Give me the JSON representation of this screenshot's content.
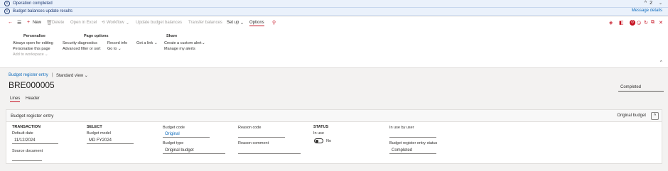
{
  "messages": [
    {
      "text": "Operation completed"
    },
    {
      "text": "Budget balances update results",
      "link": "Message details"
    }
  ],
  "message_counter": "2",
  "toolbar": {
    "new": "New",
    "delete": "Delete",
    "open_in_excel": "Open in Excel",
    "workflow": "Workflow",
    "update_budget_balances": "Update budget balances",
    "transfer_balances": "Transfer balances",
    "set_up": "Set up",
    "options": "Options"
  },
  "ribbon": {
    "personalise": {
      "title": "Personalise",
      "items": [
        "Always open for editing",
        "Personalise this page",
        "Add to workspace"
      ]
    },
    "page_options": {
      "title": "Page options",
      "items": [
        "Security diagnostics",
        "Advanced filter or sort",
        "Record info",
        "Go to"
      ]
    },
    "get_link": "Get a link",
    "share": {
      "title": "Share",
      "items": [
        "Create a custom alert",
        "Manage my alerts"
      ]
    }
  },
  "breadcrumb": {
    "entry": "Budget register entry",
    "separator": "|",
    "view": "Standard view"
  },
  "page_title": "BRE000005",
  "header_status": "Completed",
  "tabs": [
    "Lines",
    "Header"
  ],
  "panel": {
    "title": "Budget register entry",
    "right_label": "Original budget",
    "transaction": {
      "heading": "TRANSACTION",
      "default_date_label": "Default date",
      "default_date": "11/12/2024",
      "source_document_label": "Source document",
      "source_document": ""
    },
    "select": {
      "heading": "SELECT",
      "budget_model_label": "Budget model",
      "budget_model": "MD FY2024"
    },
    "budget": {
      "budget_code_label": "Budget code",
      "budget_code": "Original",
      "budget_type_label": "Budget type",
      "budget_type": "Original budget"
    },
    "reason": {
      "reason_code_label": "Reason code",
      "reason_code": "",
      "reason_comment_label": "Reason comment",
      "reason_comment": ""
    },
    "status": {
      "heading": "STATUS",
      "in_use_label": "In use",
      "in_use_value": "No"
    },
    "user": {
      "in_use_by_label": "In use by user",
      "in_use_by": "",
      "entry_status_label": "Budget register entry status",
      "entry_status": "Completed"
    }
  }
}
